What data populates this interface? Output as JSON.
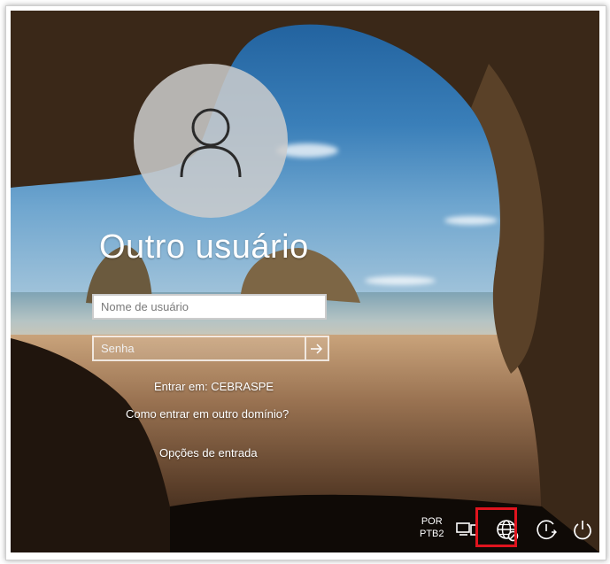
{
  "user_title": "Outro usuário",
  "username_field": {
    "placeholder": "Nome de usuário",
    "value": ""
  },
  "password_field": {
    "placeholder": "Senha",
    "value": ""
  },
  "sign_in_to": "Entrar em: CEBRASPE",
  "other_domain_link": "Como entrar em outro domínio?",
  "sign_in_options_link": "Opções de entrada",
  "tray": {
    "language_top": "POR",
    "language_bottom": "PTB2",
    "icons": [
      "network-display-icon",
      "globe-disconnected-icon",
      "ease-of-access-icon",
      "power-icon"
    ]
  },
  "colors": {
    "highlight": "#e0141e",
    "text": "#ffffff"
  }
}
